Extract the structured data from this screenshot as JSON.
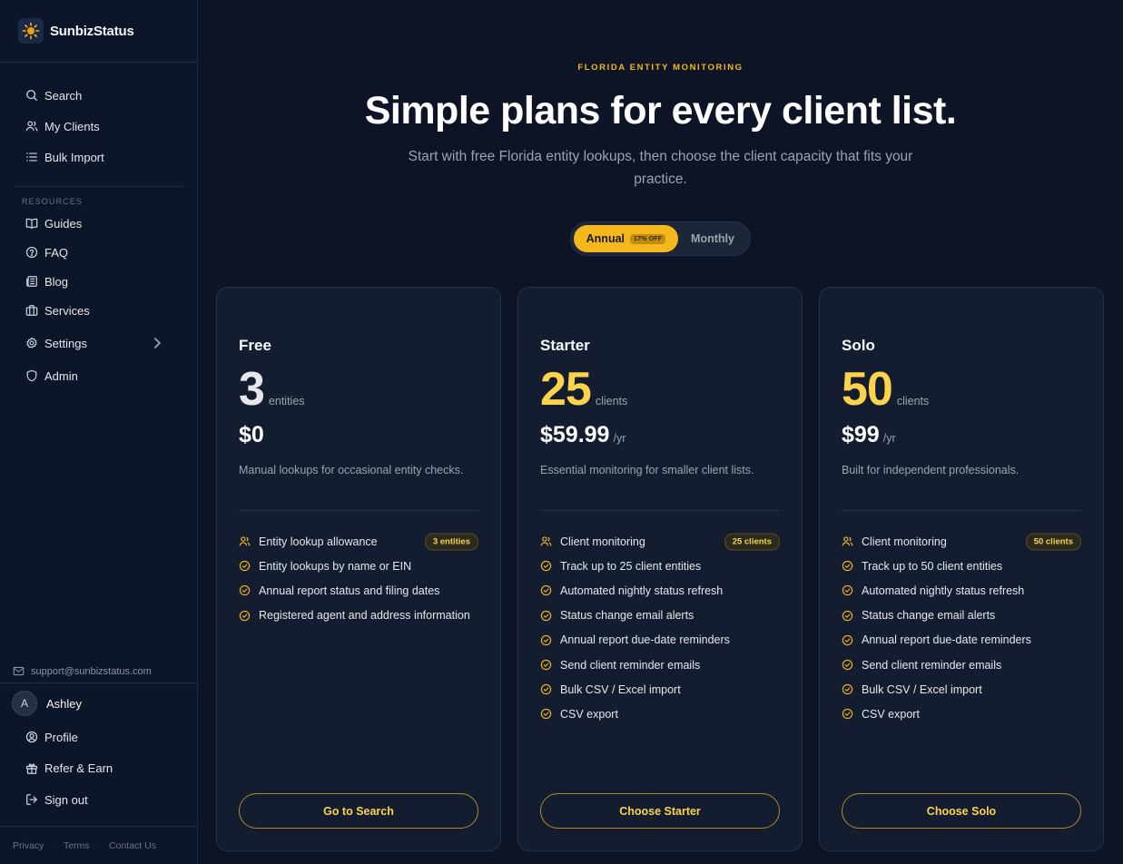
{
  "brand": {
    "name": "SunbizStatus"
  },
  "nav": {
    "primary": [
      {
        "label": "Search",
        "icon": "search-icon"
      },
      {
        "label": "My Clients",
        "icon": "users-icon"
      },
      {
        "label": "Bulk Import",
        "icon": "list-icon"
      }
    ],
    "resources_heading": "RESOURCES",
    "resources": [
      {
        "label": "Guides",
        "icon": "book-icon"
      },
      {
        "label": "FAQ",
        "icon": "help-circle-icon"
      },
      {
        "label": "Blog",
        "icon": "newspaper-icon"
      },
      {
        "label": "Services",
        "icon": "briefcase-icon"
      },
      {
        "label": "Settings",
        "icon": "gear-icon"
      },
      {
        "label": "Admin",
        "icon": "shield-icon"
      }
    ]
  },
  "support_email": "support@sunbizstatus.com",
  "user": {
    "initial": "A",
    "name": "Ashley",
    "menu": [
      {
        "label": "Profile",
        "icon": "user-circle-icon"
      },
      {
        "label": "Refer & Earn",
        "icon": "gift-icon"
      },
      {
        "label": "Sign out",
        "icon": "sign-out-icon"
      }
    ]
  },
  "footer": {
    "privacy": "Privacy",
    "terms": "Terms",
    "contact": "Contact Us"
  },
  "hero": {
    "eyebrow": "FLORIDA ENTITY MONITORING",
    "title": "Simple plans for every client list.",
    "subtitle": "Start with free Florida entity lookups, then choose the client capacity that fits your practice."
  },
  "billing_toggle": {
    "annual": "Annual",
    "annual_badge": "17% OFF",
    "monthly": "Monthly",
    "selected": "Annual"
  },
  "plans": [
    {
      "name": "Free",
      "capacity": "3",
      "capacity_unit": "entities",
      "price": "$0",
      "price_period": "",
      "description": "Manual lookups for occasional entity checks.",
      "features": [
        {
          "label": "Entity lookup allowance",
          "badge": "3 entities",
          "icon": "users-icon"
        },
        {
          "label": "Entity lookups by name or EIN",
          "icon": "check-circle-icon"
        },
        {
          "label": "Annual report status and filing dates",
          "icon": "check-circle-icon"
        },
        {
          "label": "Registered agent and address information",
          "icon": "check-circle-icon"
        }
      ],
      "cta": "Go to Search"
    },
    {
      "name": "Starter",
      "capacity": "25",
      "capacity_unit": "clients",
      "price": "$59.99",
      "price_period": "/yr",
      "description": "Essential monitoring for smaller client lists.",
      "features": [
        {
          "label": "Client monitoring",
          "badge": "25 clients",
          "icon": "users-icon"
        },
        {
          "label": "Track up to 25 client entities",
          "icon": "check-circle-icon"
        },
        {
          "label": "Automated nightly status refresh",
          "icon": "check-circle-icon"
        },
        {
          "label": "Status change email alerts",
          "icon": "check-circle-icon"
        },
        {
          "label": "Annual report due-date reminders",
          "icon": "check-circle-icon"
        },
        {
          "label": "Send client reminder emails",
          "icon": "check-circle-icon"
        },
        {
          "label": "Bulk CSV / Excel import",
          "icon": "check-circle-icon"
        },
        {
          "label": "CSV export",
          "icon": "check-circle-icon"
        }
      ],
      "cta": "Choose Starter"
    },
    {
      "name": "Solo",
      "capacity": "50",
      "capacity_unit": "clients",
      "price": "$99",
      "price_period": "/yr",
      "description": "Built for independent professionals.",
      "features": [
        {
          "label": "Client monitoring",
          "badge": "50 clients",
          "icon": "users-icon"
        },
        {
          "label": "Track up to 50 client entities",
          "icon": "check-circle-icon"
        },
        {
          "label": "Automated nightly status refresh",
          "icon": "check-circle-icon"
        },
        {
          "label": "Status change email alerts",
          "icon": "check-circle-icon"
        },
        {
          "label": "Annual report due-date reminders",
          "icon": "check-circle-icon"
        },
        {
          "label": "Send client reminder emails",
          "icon": "check-circle-icon"
        },
        {
          "label": "Bulk CSV / Excel import",
          "icon": "check-circle-icon"
        },
        {
          "label": "CSV export",
          "icon": "check-circle-icon"
        }
      ],
      "cta": "Choose Solo"
    }
  ],
  "colors": {
    "background": "#0c1425",
    "card": "#141d30",
    "accent": "#f5b81c",
    "accent_text": "#fcd34d"
  }
}
